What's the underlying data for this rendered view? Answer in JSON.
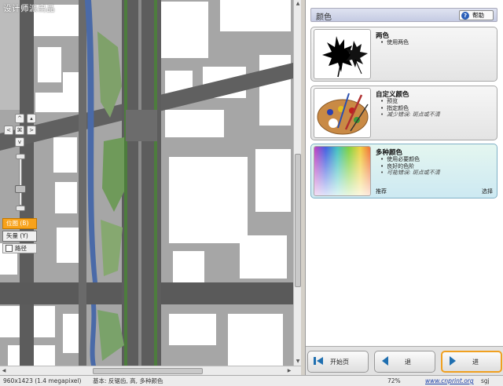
{
  "map": {
    "watermark": "设计师派出品",
    "nav": {
      "up": "^",
      "down": "v",
      "left": "<",
      "right": ">",
      "center": "⌘"
    },
    "layers": {
      "map_label": "位图 (B)",
      "vector_label": "矢量 (Y)",
      "path_label": "路径"
    }
  },
  "panel": {
    "title": "颜色",
    "help_label": "帮助",
    "options": [
      {
        "title": "两色",
        "bullets": [
          "使用两色"
        ]
      },
      {
        "title": "自定义颜色",
        "bullets": [
          "预览",
          "指定颜色",
          "减少错误: 斑点或不清"
        ]
      },
      {
        "title": "多种颜色",
        "bullets": [
          "使用必要颜色",
          "良好的色阶",
          "可能错误: 斑点或不清"
        ],
        "left_label": "推荐",
        "right_label": "选择"
      }
    ],
    "buttons": {
      "start": "开始页",
      "back": "退",
      "next": "进"
    }
  },
  "status": {
    "dimensions": "960x1423 (1.4 megapixel)",
    "mode": "基本: 反锯齿, 高, 多种颜色",
    "zoom": "72%",
    "url": "www.cnprint.org",
    "tail": "sgj"
  },
  "colors": {
    "accent": "#f7a21b",
    "header": "#c5cbe3",
    "selected": "#cde9f2"
  }
}
